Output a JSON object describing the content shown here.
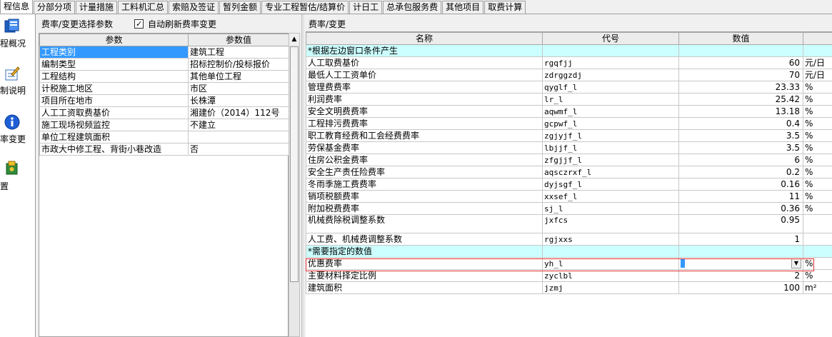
{
  "tabs": [
    "程信息",
    "分部分项",
    "计量措施",
    "工料机汇总",
    "索赔及签证",
    "暂列金额",
    "专业工程暂估/结算价",
    "计日工",
    "总承包服务费",
    "其他项目",
    "取费计算"
  ],
  "sidebar": {
    "items": [
      {
        "label": "程概况",
        "icon": "overview-icon"
      },
      {
        "label": "制说明",
        "icon": "edit-notes-icon"
      },
      {
        "label": "率变更",
        "icon": "info-icon"
      },
      {
        "label": "置",
        "icon": "settings-icon"
      }
    ]
  },
  "left_panel": {
    "title": "费率/变更选择参数",
    "auto_refresh_label": "自动刷新费率变更",
    "auto_refresh_checked": "✓",
    "columns": [
      "参数",
      "参数值"
    ],
    "rows": [
      [
        "工程类别",
        "建筑工程"
      ],
      [
        "编制类型",
        "招标控制价/投标报价"
      ],
      [
        "工程结构",
        "其他单位工程"
      ],
      [
        "计税施工地区",
        "市区"
      ],
      [
        "项目所在地市",
        "长株潭"
      ],
      [
        "人工工资取费基价",
        "湘建价（2014）112号"
      ],
      [
        "施工现场视频监控",
        "不建立"
      ],
      [
        "单位工程建筑面积",
        ""
      ],
      [
        "市政大中修工程、背街小巷改造",
        "否"
      ]
    ]
  },
  "right_panel": {
    "title": "费率/变更",
    "columns": [
      "名称",
      "代号",
      "数值",
      ""
    ],
    "section1": "*根据左边窗口条件产生",
    "rows1": [
      [
        "人工取费基价",
        "rgqfjj",
        "60",
        "元/日"
      ],
      [
        "最低人工工资单价",
        "zdrggzdj",
        "70",
        "元/日"
      ],
      [
        "管理费费率",
        "qyglf_l",
        "23.33",
        "%"
      ],
      [
        "利润费率",
        "lr_l",
        "25.42",
        "%"
      ],
      [
        "安全文明费费率",
        "aqwmf_l",
        "13.18",
        "%"
      ],
      [
        "工程排污费费率",
        "gcpwf_l",
        "0.4",
        "%"
      ],
      [
        "职工教育经费和工会经费费率",
        "zgjyjf_l",
        "3.5",
        "%"
      ],
      [
        "劳保基金费率",
        "lbjjf_l",
        "3.5",
        "%"
      ],
      [
        "住房公积金费率",
        "zfgjjf_l",
        "6",
        "%"
      ],
      [
        "安全生产责任险费率",
        "aqsczrxf_l",
        "0.2",
        "%"
      ],
      [
        "冬雨季施工费费率",
        "dyjsgf_l",
        "0.16",
        "%"
      ],
      [
        "销项税额费率",
        "xxsef_l",
        "11",
        "%"
      ],
      [
        "附加税费费率",
        "sj_l",
        "0.36",
        "%"
      ],
      [
        "机械费除税调整系数",
        "jxfcs",
        "0.95",
        ""
      ],
      [
        "人工费、机械费调整系数",
        "rgjxxs",
        "1",
        ""
      ]
    ],
    "section2": "*需要指定的数值",
    "rows2": [
      [
        "优惠费率",
        "yh_l",
        "",
        "%"
      ],
      [
        "主要材料择定比例",
        "zyclbl",
        "2",
        "%"
      ],
      [
        "建筑面积",
        "jzmj",
        "100",
        "m²"
      ]
    ]
  }
}
